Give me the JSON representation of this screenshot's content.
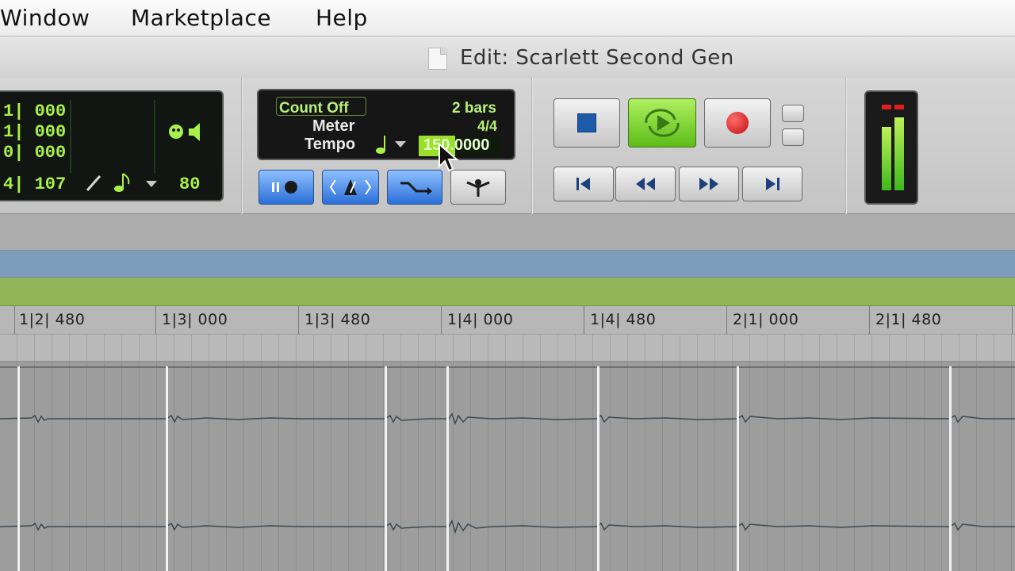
{
  "menu": {
    "window": "Window",
    "marketplace": "Marketplace",
    "help": "Help"
  },
  "window": {
    "title": "Edit: Scarlett Second Gen",
    "icon": "document-icon"
  },
  "counter": {
    "line1": "1| 000",
    "line2": "1| 000",
    "line3": "0| 000",
    "line4": "4| 107",
    "value": "80",
    "icons": [
      "speaker-icon",
      "pencil-icon",
      "eighth-note-icon",
      "dropdown-arrow-icon"
    ]
  },
  "midi_panel": {
    "count_off": "Count Off",
    "bars": "2 bars",
    "meter_label": "Meter",
    "meter_value": "4/4",
    "tempo_label": "Tempo",
    "tempo_value": "150.0000",
    "icons": [
      "quarter-note-icon",
      "dropdown-arrow-icon"
    ]
  },
  "midi_buttons": [
    {
      "name": "wait-for-note-button",
      "icon": "pause-record-icon"
    },
    {
      "name": "metronome-button",
      "icon": "metronome-icon"
    },
    {
      "name": "midi-merge-button",
      "icon": "merge-icon"
    },
    {
      "name": "conductor-button",
      "icon": "conductor-icon"
    }
  ],
  "transport": {
    "stop": "stop-icon",
    "play": "play-loop-icon",
    "record": "record-icon",
    "return_to_zero": "return-to-zero-icon",
    "rewind": "rewind-icon",
    "fast_forward": "fast-forward-icon",
    "go_to_end": "go-to-end-icon"
  },
  "ruler": {
    "labels": [
      "1|2| 480",
      "1|3| 000",
      "1|3| 480",
      "1|4| 000",
      "1|4| 480",
      "2|1| 000",
      "2|1| 480"
    ]
  },
  "colors": {
    "lcd_green": "#a8f04a",
    "button_blue": "#2b6fd8",
    "play_green": "#5cbc18",
    "record_red": "#d01818",
    "ruler_blue": "#7c9cbc",
    "ruler_green": "#92b55a"
  }
}
